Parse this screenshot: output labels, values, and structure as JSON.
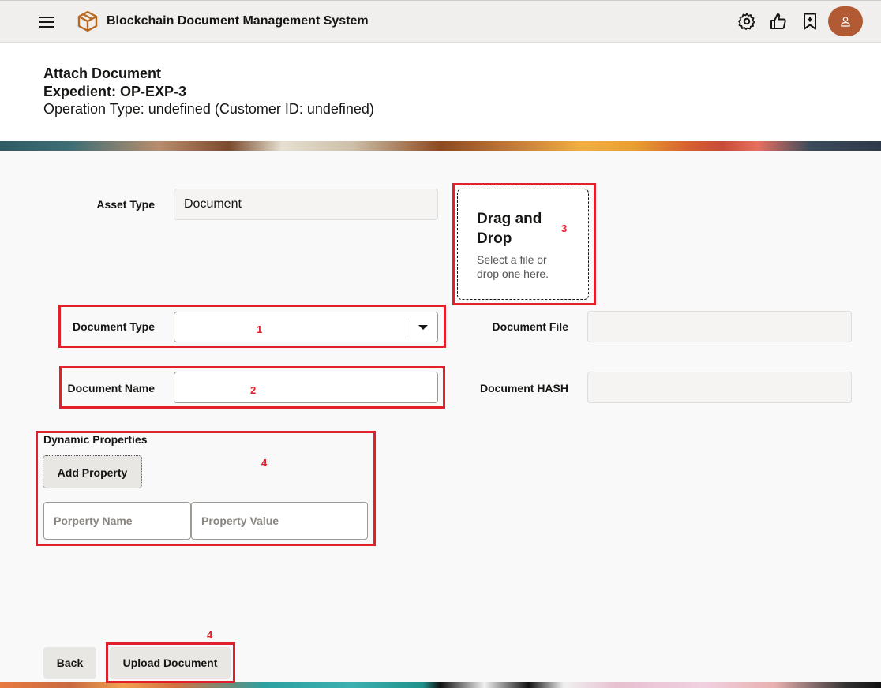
{
  "header": {
    "app_title": "Blockchain Document Management System",
    "icons": [
      "menu-icon",
      "cube-logo-icon",
      "settings-icon",
      "thumbs-up-icon",
      "bookmark-add-icon",
      "user-avatar-icon"
    ],
    "avatar_color": "#b15a34"
  },
  "page": {
    "title": "Attach Document",
    "expedient": "Expedient: OP-EXP-3",
    "operation": "Operation Type: undefined (Customer ID: undefined)"
  },
  "form": {
    "asset_type_label": "Asset Type",
    "asset_type_value": "Document",
    "document_type_label": "Document Type",
    "document_type_value": "",
    "document_name_label": "Document Name",
    "document_name_value": "",
    "document_file_label": "Document File",
    "document_file_value": "",
    "document_hash_label": "Document HASH",
    "document_hash_value": ""
  },
  "dropzone": {
    "title": "Drag and Drop",
    "subtitle": "Select a file or drop one here."
  },
  "dynamic": {
    "title": "Dynamic Properties",
    "add_button": "Add Property",
    "property_name_placeholder": "Porperty Name",
    "property_value_placeholder": "Property Value"
  },
  "footer": {
    "back_button": "Back",
    "upload_button": "Upload Document"
  },
  "annotations": {
    "n1": "1",
    "n2": "2",
    "n3": "3",
    "n4a": "4",
    "n4b": "4",
    "color": "#e0202a"
  }
}
